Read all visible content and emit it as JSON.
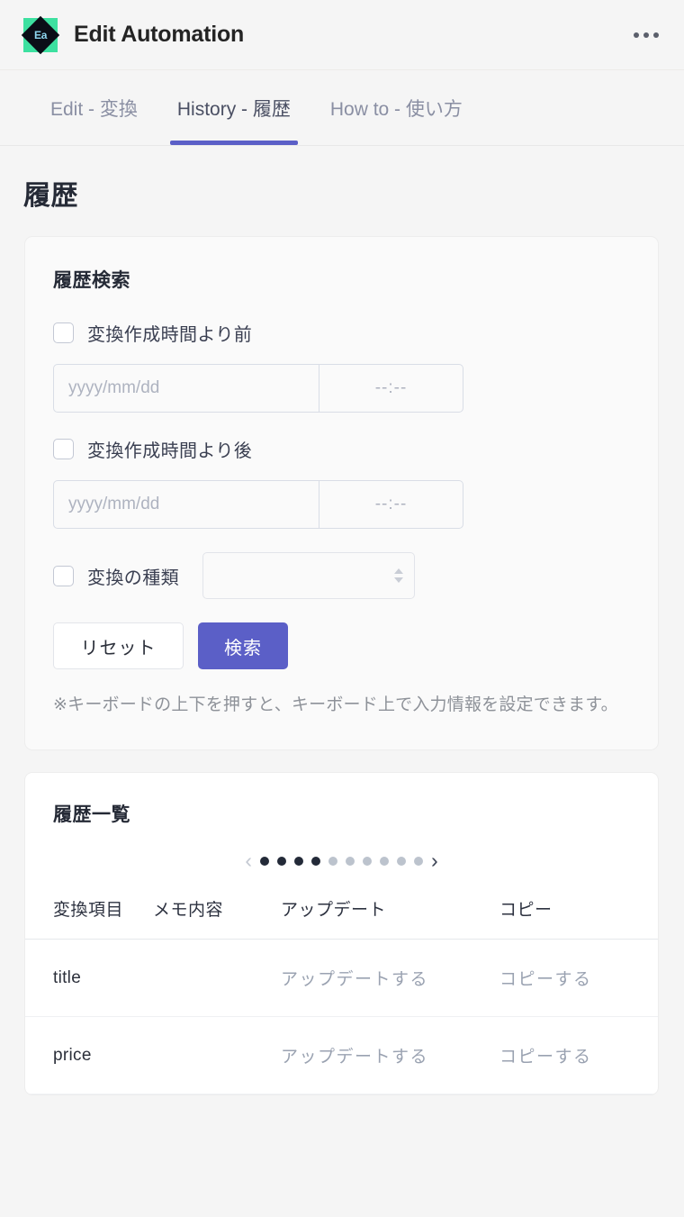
{
  "header": {
    "logo_text": "Ea",
    "logo_icon": "app-logo-icon",
    "title": "Edit Automation",
    "overflow_icon": "more-horizontal-icon",
    "logo_bg": "#3DE0A0",
    "accent": "#5B5FC7"
  },
  "tabs": [
    {
      "label": "Edit - 変換",
      "active": false
    },
    {
      "label": "History - 履歴",
      "active": true
    },
    {
      "label": "How to - 使い方",
      "active": false
    }
  ],
  "page": {
    "title": "履歴"
  },
  "search_card": {
    "title": "履歴検索",
    "before": {
      "checkbox_label": "変換作成時間より前",
      "checked": false,
      "date_value": "",
      "date_placeholder": "yyyy/mm/dd",
      "time_value": "",
      "time_placeholder": "--:--"
    },
    "after": {
      "checkbox_label": "変換作成時間より後",
      "checked": false,
      "date_value": "",
      "date_placeholder": "yyyy/mm/dd",
      "time_value": "",
      "time_placeholder": "--:--"
    },
    "type": {
      "checkbox_label": "変換の種類",
      "checked": false,
      "selected_value": "",
      "stepper_icon": "up-down-stepper-icon"
    },
    "reset_label": "リセット",
    "search_label": "検索",
    "note": "※キーボードの上下を押すと、キーボード上で入力情報を設定できます。"
  },
  "list_card": {
    "title": "履歴一覧",
    "pager": {
      "prev_icon": "chevron-left-icon",
      "next_icon": "chevron-right-icon",
      "total_dots": 10,
      "active_dots": 4
    },
    "columns": [
      "変換項目",
      "メモ内容",
      "アップデート",
      "コピー"
    ],
    "rows": [
      {
        "item": "title",
        "memo": "",
        "update": "アップデートする",
        "copy": "コピーする"
      },
      {
        "item": "price",
        "memo": "",
        "update": "アップデートする",
        "copy": "コピーする"
      }
    ]
  }
}
